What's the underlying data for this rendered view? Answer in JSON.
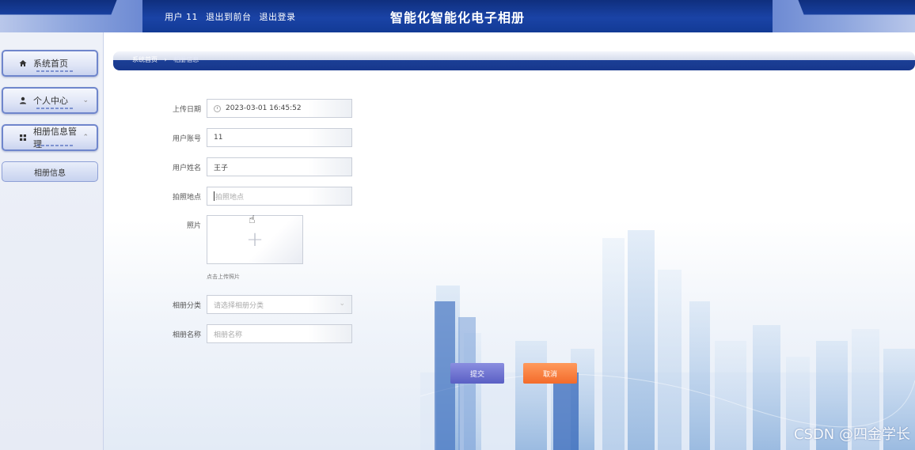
{
  "header": {
    "user_label": "用户 11",
    "to_front_link": "退出到前台",
    "logout_link": "退出登录",
    "title": "智能化智能化电子相册"
  },
  "sidebar": {
    "items": [
      {
        "label": "系统首页",
        "icon": "home-icon"
      },
      {
        "label": "个人中心",
        "icon": "user-icon",
        "arrow": "chevron-down-icon"
      },
      {
        "label": "相册信息管理",
        "icon": "grid-icon",
        "arrow": "chevron-up-icon"
      }
    ],
    "sub_item": "相册信息"
  },
  "breadcrumb": {
    "home": "系统首页",
    "separator": "›",
    "current": "相册信息"
  },
  "form": {
    "upload_date": {
      "label": "上传日期",
      "value": "2023-03-01 16:45:52"
    },
    "user_account": {
      "label": "用户账号",
      "value": "11"
    },
    "user_name": {
      "label": "用户姓名",
      "value": "王子"
    },
    "photo_location": {
      "label": "拍照地点",
      "placeholder": "拍照地点"
    },
    "photo": {
      "label": "照片",
      "hint": "点击上传照片"
    },
    "album_category": {
      "label": "相册分类",
      "placeholder": "请选择相册分类"
    },
    "album_name": {
      "label": "相册名称",
      "placeholder": "相册名称"
    }
  },
  "buttons": {
    "submit": "提交",
    "cancel": "取消"
  },
  "watermark": "CSDN @四金学长",
  "colors": {
    "header_blue": "#1a43a6",
    "submit": "#6a6fd0",
    "cancel": "#f47a3a"
  }
}
